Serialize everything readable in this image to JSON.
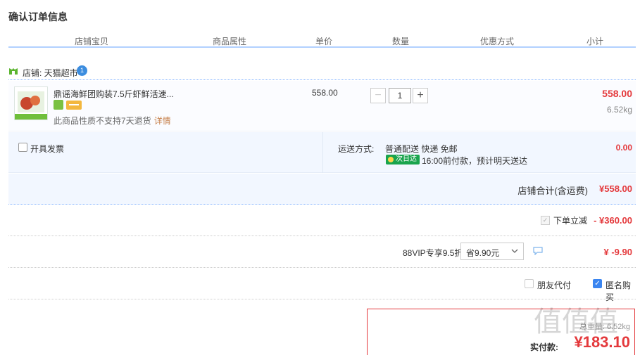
{
  "page_title": "确认订单信息",
  "columns": {
    "store_item": "店铺宝贝",
    "attributes": "商品属性",
    "unit_price": "单价",
    "quantity": "数量",
    "discount_method": "优惠方式",
    "subtotal": "小计"
  },
  "shop": {
    "label": "店铺: 天猫超市",
    "badge_text": "1"
  },
  "item": {
    "title": "鼎谣海鲜团购装7.5斤虾鲜活速...",
    "note": "此商品性质不支持7天退货",
    "details_link": "详情",
    "unit_price": "558.00",
    "quantity": "1",
    "minus": "−",
    "plus": "+",
    "subtotal": "558.00",
    "weight": "6.52kg"
  },
  "shipping": {
    "invoice_label": "开具发票",
    "method_label": "运送方式:",
    "method": "普通配送 快递 免邮",
    "next_day_badge": "次日达",
    "delivery_note": "16:00前付款，预计明天送达",
    "fee": "0.00"
  },
  "shop_total": {
    "label": "店铺合计(含运费)",
    "value": "¥558.00"
  },
  "instant_discount": {
    "check": "✓",
    "label": "下单立减",
    "value": "- ¥360.00"
  },
  "vip": {
    "label": "88VIP专享9.5折",
    "select_value": "省9.90元",
    "value": "¥ -9.90"
  },
  "payment_options": {
    "friend_pay": "朋友代付",
    "anonymous": "匿名购买",
    "anonymous_check": "✓"
  },
  "total": {
    "weight": "总重量: 6.52kg",
    "label": "实付款:",
    "value": "¥183.10"
  },
  "watermark": "值值值",
  "colors": {
    "price_red": "#e4393c",
    "header_blue": "#b2d1ff",
    "row_bg": "#f2f7ff",
    "next_day_green": "#19a44d",
    "checkbox_blue": "#3a85f0"
  }
}
